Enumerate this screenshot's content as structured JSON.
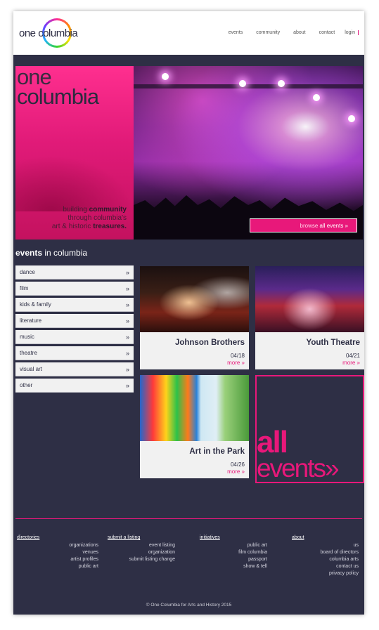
{
  "logo": {
    "text": "one columbia"
  },
  "nav": [
    "events",
    "community",
    "about",
    "contact",
    "login"
  ],
  "hero": {
    "title_line1": "one",
    "title_line2": "columbia",
    "tagline": {
      "l1a": "building ",
      "l1b": "community",
      "l2": "through columbia's",
      "l3a": "art & historic ",
      "l3b": "treasures."
    },
    "browse_prefix": "browse ",
    "browse_bold": "all events »"
  },
  "events_heading": {
    "bold": "events",
    "rest": " in columbia"
  },
  "categories": [
    "dance",
    "film",
    "kids & family",
    "literature",
    "music",
    "theatre",
    "visual art",
    "other"
  ],
  "category_arrow": "»",
  "cards": [
    {
      "title": "Johnson Brothers",
      "date": "04/18",
      "more": "more »"
    },
    {
      "title": "Youth Theatre",
      "date": "04/21",
      "more": "more »"
    },
    {
      "title": "Art in the Park",
      "date": "04/26",
      "more": "more »"
    }
  ],
  "all_events": {
    "line1": "all",
    "line2": "events»"
  },
  "footer": {
    "directories": {
      "heading": "directories",
      "items": [
        "organizations",
        "venues",
        "artist profiles",
        "public art"
      ]
    },
    "submit": {
      "heading": "submit a listing",
      "items": [
        "event listing",
        "organization",
        "submit listing change"
      ]
    },
    "initiatives": {
      "heading": "initiatives",
      "items": [
        "public art",
        "film columbia",
        "passport",
        "show & tell"
      ]
    },
    "about": {
      "heading": "about",
      "items": [
        "us",
        "board of directors",
        "columbia arts",
        "contact us",
        "privacy policy"
      ]
    }
  },
  "copyright": "© One Columbia for Arts and History 2015",
  "colors": {
    "accent": "#e8187a",
    "background": "#2e2f45"
  }
}
